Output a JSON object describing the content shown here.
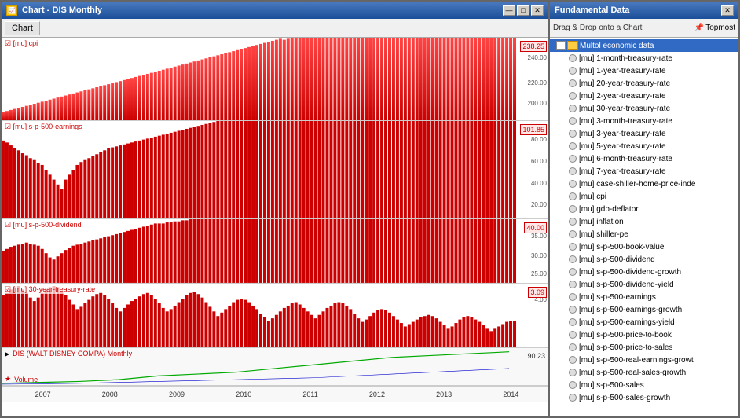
{
  "chart_window": {
    "title": "Chart - DIS Monthly",
    "toolbar": {
      "chart_label": "Chart"
    },
    "min_btn": "—",
    "max_btn": "□",
    "close_btn": "✕"
  },
  "panels": [
    {
      "id": "cpi",
      "label": "[mu] cpi",
      "value": "238.25",
      "y_labels": [
        "240.00",
        "220.00",
        "200.00"
      ],
      "height_pct": 22,
      "bar_color": "#cc0000"
    },
    {
      "id": "sp500earnings",
      "label": "[mu] s-p-500-earnings",
      "value": "101.85",
      "y_labels": [
        "80.00",
        "60.00",
        "40.00",
        "20.00"
      ],
      "height_pct": 28,
      "bar_color": "#cc0000"
    },
    {
      "id": "sp500dividend",
      "label": "[mu] s-p-500-dividend",
      "value": "40.00",
      "y_labels": [
        "35.00",
        "30.00",
        "25.00"
      ],
      "height_pct": 17,
      "bar_color": "#cc0000"
    },
    {
      "id": "treasury30",
      "label": "[mu] 30-year-treasury-rate",
      "value": "3.09",
      "y_labels": [
        "4.00"
      ],
      "height_pct": 17,
      "bar_color": "#cc0000"
    }
  ],
  "volume_panel": {
    "label": "▶ DIS (WALT DISNEY COMPA) Monthly",
    "sublabel": "★ Volume",
    "value": "90.23"
  },
  "x_axis_labels": [
    "2007",
    "2008",
    "2009",
    "2010",
    "2011",
    "2012",
    "2013",
    "2014"
  ],
  "fundamental_panel": {
    "title": "Fundamental Data",
    "close_btn": "✕",
    "drag_drop_label": "Drag & Drop onto a Chart",
    "topmost_label": "Topmost",
    "items": [
      {
        "type": "toggle",
        "label": "⊟",
        "icon": "folder",
        "text": "Multol economic data",
        "selected": true,
        "indent": 0
      },
      {
        "type": "circle",
        "text": "[mu] 1-month-treasury-rate",
        "indent": 1
      },
      {
        "type": "circle",
        "text": "[mu] 1-year-treasury-rate",
        "indent": 1
      },
      {
        "type": "circle",
        "text": "[mu] 20-year-treasury-rate",
        "indent": 1
      },
      {
        "type": "circle",
        "text": "[mu] 2-year-treasury-rate",
        "indent": 1
      },
      {
        "type": "circle",
        "text": "[mu] 30-year-treasury-rate",
        "indent": 1
      },
      {
        "type": "circle",
        "text": "[mu] 3-month-treasury-rate",
        "indent": 1
      },
      {
        "type": "circle",
        "text": "[mu] 3-year-treasury-rate",
        "indent": 1
      },
      {
        "type": "circle",
        "text": "[mu] 5-year-treasury-rate",
        "indent": 1
      },
      {
        "type": "circle",
        "text": "[mu] 6-month-treasury-rate",
        "indent": 1
      },
      {
        "type": "circle",
        "text": "[mu] 7-year-treasury-rate",
        "indent": 1
      },
      {
        "type": "circle",
        "text": "[mu] case-shiller-home-price-inde",
        "indent": 1
      },
      {
        "type": "circle",
        "text": "[mu] cpi",
        "indent": 1
      },
      {
        "type": "circle",
        "text": "[mu] gdp-deflator",
        "indent": 1
      },
      {
        "type": "circle",
        "text": "[mu] inflation",
        "indent": 1
      },
      {
        "type": "circle",
        "text": "[mu] shiller-pe",
        "indent": 1
      },
      {
        "type": "circle",
        "text": "[mu] s-p-500-book-value",
        "indent": 1
      },
      {
        "type": "circle",
        "text": "[mu] s-p-500-dividend",
        "indent": 1
      },
      {
        "type": "circle",
        "text": "[mu] s-p-500-dividend-growth",
        "indent": 1
      },
      {
        "type": "circle",
        "text": "[mu] s-p-500-dividend-yield",
        "indent": 1
      },
      {
        "type": "circle",
        "text": "[mu] s-p-500-earnings",
        "indent": 1
      },
      {
        "type": "circle",
        "text": "[mu] s-p-500-earnings-growth",
        "indent": 1
      },
      {
        "type": "circle",
        "text": "[mu] s-p-500-earnings-yield",
        "indent": 1
      },
      {
        "type": "circle",
        "text": "[mu] s-p-500-price-to-book",
        "indent": 1
      },
      {
        "type": "circle",
        "text": "[mu] s-p-500-price-to-sales",
        "indent": 1
      },
      {
        "type": "circle",
        "text": "[mu] s-p-500-real-earnings-growt",
        "indent": 1
      },
      {
        "type": "circle",
        "text": "[mu] s-p-500-real-sales-growth",
        "indent": 1
      },
      {
        "type": "circle",
        "text": "[mu] s-p-500-sales",
        "indent": 1
      },
      {
        "type": "circle",
        "text": "[mu] s-p-500-sales-growth",
        "indent": 1
      }
    ]
  }
}
